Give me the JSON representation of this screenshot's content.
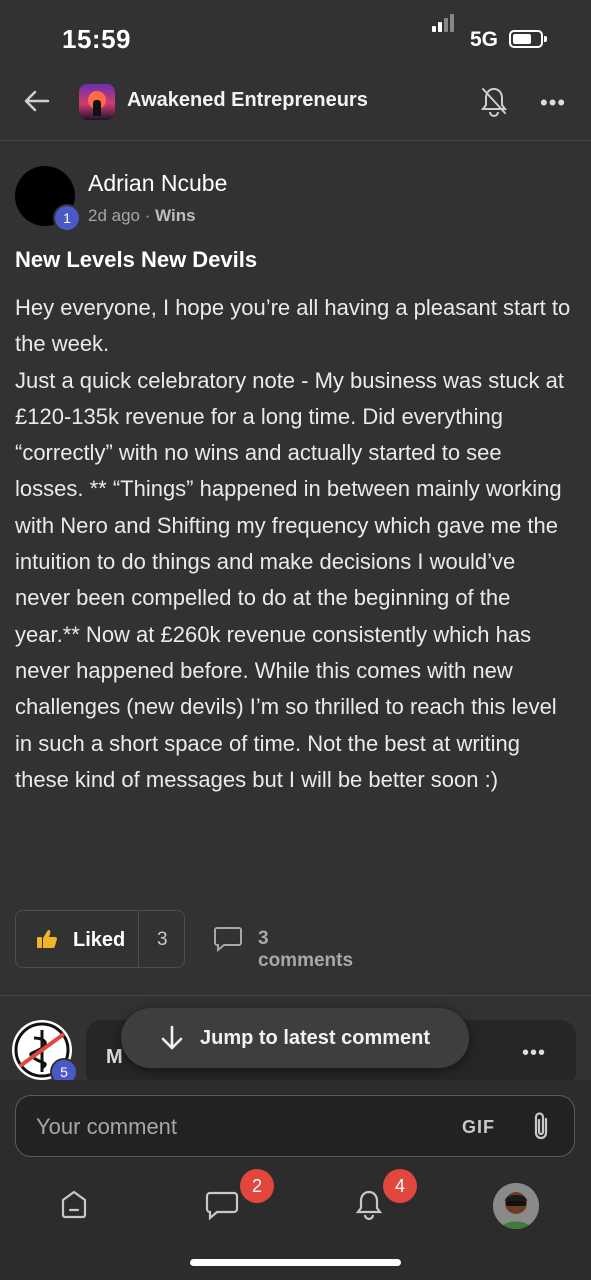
{
  "status_bar": {
    "time": "15:59",
    "network": "5G"
  },
  "header": {
    "group_name": "Awakened Entrepreneurs",
    "back_icon": "back-arrow-icon",
    "notify_icon": "bell-off-icon",
    "more_icon": "more-icon"
  },
  "post": {
    "author": "Adrian Ncube",
    "level": "1",
    "time": "2d ago",
    "separator": "·",
    "category": "Wins",
    "title": "New Levels New Devils",
    "paragraphs": [
      "Hey everyone, I hope you’re all having a pleasant start to the week.",
      "Just a quick celebratory note - My business was stuck at £120-135k revenue for a long time. Did everything “correctly” with no wins and actually started to see losses. ** “Things” happened in between mainly working with Nero and Shifting my frequency which gave me the intuition to do things and make decisions I would’ve never been compelled to do at the beginning of the year.** Now at £260k revenue consistently which has never happened before. While this comes with new challenges (new devils) I’m so thrilled to reach this level in such a short space of time. Not the best at writing these kind of messages but I will be better soon :)"
    ],
    "like_label": "Liked",
    "like_count": "3",
    "comments_label": "3 comments"
  },
  "comment_preview": {
    "level": "5",
    "name_partial": "M"
  },
  "jump_button": {
    "label": "Jump to latest comment"
  },
  "composer": {
    "placeholder": "Your comment",
    "gif_label": "GIF"
  },
  "bottom_nav": {
    "chat_badge": "2",
    "notifications_badge": "4"
  },
  "colors": {
    "background": "#323232",
    "badge": "#e1473d",
    "level": "#4a59c7",
    "like_icon": "#f0b429"
  }
}
